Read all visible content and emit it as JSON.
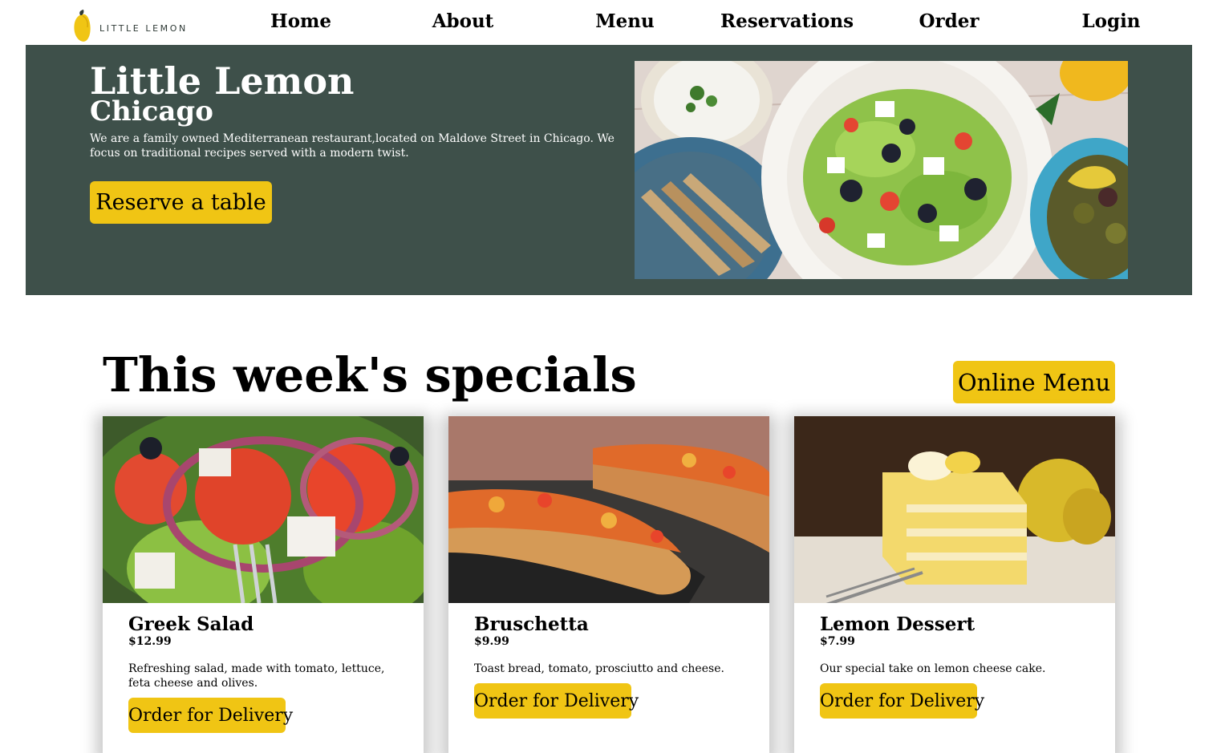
{
  "brand": {
    "name": "LITTLE LEMON"
  },
  "nav": {
    "items": [
      "Home",
      "About",
      "Menu",
      "Reservations",
      "Order",
      "Login"
    ]
  },
  "hero": {
    "title": "Little Lemon",
    "subtitle": "Chicago",
    "description": "We are a family owned Mediterranean restaurant,located on Maldove Street in Chicago. We focus on traditional recipes served with a modern twist.",
    "cta": "Reserve a table"
  },
  "specials": {
    "title": "This week's specials",
    "menu_button": "Online Menu",
    "items": [
      {
        "name": "Greek Salad",
        "price": "$12.99",
        "description": "Refreshing salad, made with tomato, lettuce, feta cheese and olives.",
        "button": "Order for Delivery"
      },
      {
        "name": "Bruschetta",
        "price": "$9.99",
        "description": "Toast bread, tomato, prosciutto and cheese.",
        "button": "Order for Delivery"
      },
      {
        "name": "Lemon Dessert",
        "price": "$7.99",
        "description": "Our special take on lemon cheese cake.",
        "button": "Order for Delivery"
      }
    ]
  },
  "colors": {
    "primary": "#3e504a",
    "accent": "#f0c514"
  }
}
